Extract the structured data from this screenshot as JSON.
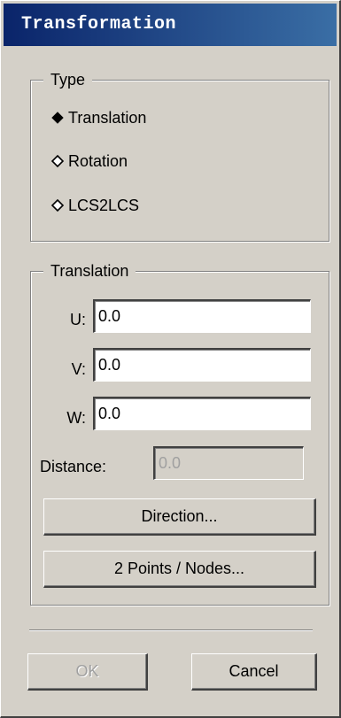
{
  "window": {
    "title": "Transformation"
  },
  "type_group": {
    "legend": "Type",
    "options": [
      {
        "label": "Translation",
        "selected": true
      },
      {
        "label": "Rotation",
        "selected": false
      },
      {
        "label": "LCS2LCS",
        "selected": false
      }
    ]
  },
  "translation_group": {
    "legend": "Translation",
    "fields": {
      "u": {
        "label": "U:",
        "value": "0.0"
      },
      "v": {
        "label": "V:",
        "value": "0.0"
      },
      "w": {
        "label": "W:",
        "value": "0.0"
      },
      "distance": {
        "label": "Distance:",
        "value": "0.0",
        "disabled": true
      }
    },
    "direction_button": "Direction...",
    "points_button": "2 Points / Nodes..."
  },
  "footer": {
    "ok_label": "OK",
    "ok_disabled": true,
    "cancel_label": "Cancel"
  },
  "icons": {
    "radio_selected": "filled-diamond",
    "radio_unselected": "hollow-diamond"
  }
}
